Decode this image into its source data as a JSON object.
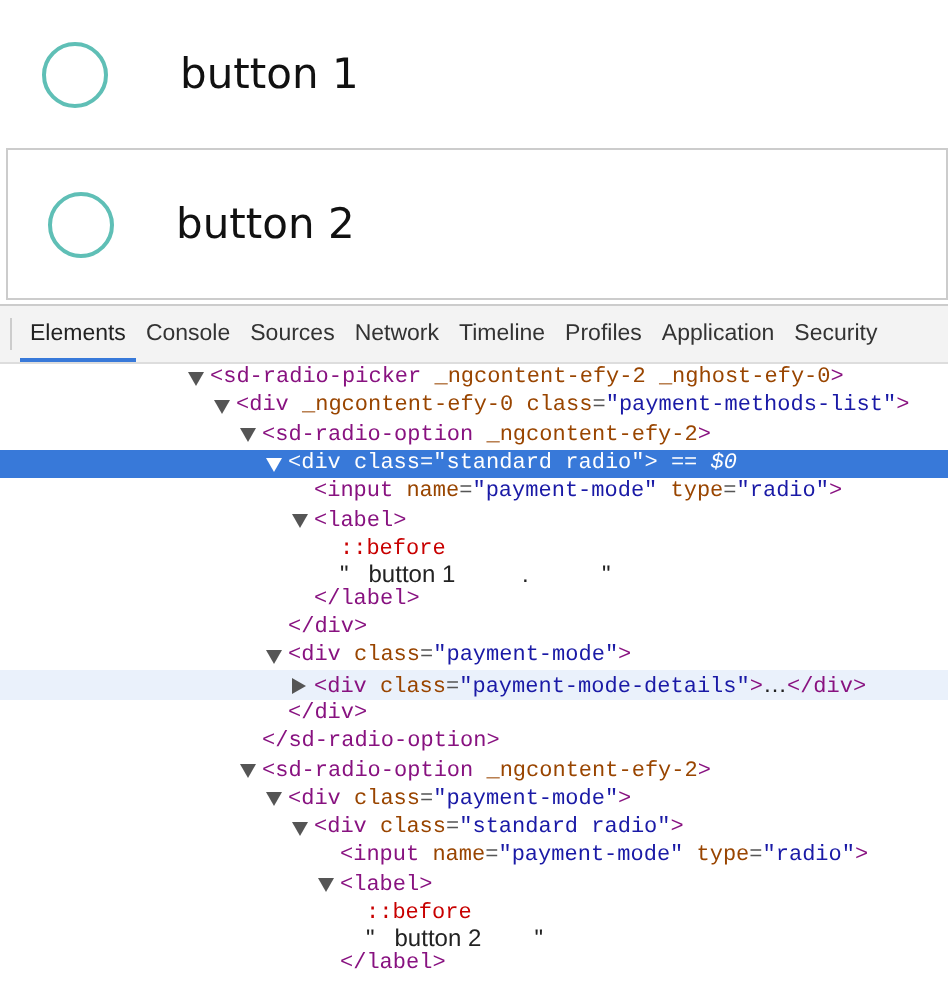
{
  "options": [
    {
      "label": "button 1",
      "selected": false,
      "hovered": false
    },
    {
      "label": "button 2",
      "selected": false,
      "hovered": true
    }
  ],
  "devtools": {
    "tabs": [
      {
        "label": "Elements",
        "selected": true
      },
      {
        "label": "Console",
        "selected": false
      },
      {
        "label": "Sources",
        "selected": false
      },
      {
        "label": "Network",
        "selected": false
      },
      {
        "label": "Timeline",
        "selected": false
      },
      {
        "label": "Profiles",
        "selected": false
      },
      {
        "label": "Application",
        "selected": false
      },
      {
        "label": "Security",
        "selected": false
      }
    ],
    "tree": [
      {
        "expanded": true,
        "selected": false,
        "hovered": false,
        "open": [
          {
            "kind": "tag",
            "t": "<sd-radio-picker"
          },
          {
            "kind": "attr",
            "t": " _ngcontent-efy-2 _nghost-efy-0"
          },
          {
            "kind": "tag",
            "t": ">"
          }
        ],
        "children": [
          {
            "expanded": true,
            "selected": false,
            "hovered": false,
            "open": [
              {
                "kind": "tag",
                "t": "<div"
              },
              {
                "kind": "attr",
                "t": " _ngcontent-efy-0 class"
              },
              {
                "kind": "punct",
                "t": "="
              },
              {
                "kind": "value",
                "t": "\"payment-methods-list\""
              },
              {
                "kind": "tag",
                "t": ">"
              }
            ],
            "children": [
              {
                "expanded": true,
                "selected": false,
                "hovered": false,
                "open": [
                  {
                    "kind": "tag",
                    "t": "<sd-radio-option"
                  },
                  {
                    "kind": "attr",
                    "t": " _ngcontent-efy-2"
                  },
                  {
                    "kind": "tag",
                    "t": ">"
                  }
                ],
                "close": [
                  {
                    "kind": "tag",
                    "t": "</sd-radio-option>"
                  }
                ],
                "children": [
                  {
                    "expanded": true,
                    "selected": true,
                    "hovered": false,
                    "open": [
                      {
                        "kind": "tag",
                        "t": "<div"
                      },
                      {
                        "kind": "attr",
                        "t": " class"
                      },
                      {
                        "kind": "punct",
                        "t": "="
                      },
                      {
                        "kind": "value",
                        "t": "\"standard radio\""
                      },
                      {
                        "kind": "tag",
                        "t": ">"
                      },
                      {
                        "kind": "marker",
                        "t": " == $0"
                      }
                    ],
                    "close": [
                      {
                        "kind": "tag",
                        "t": "</div>"
                      }
                    ],
                    "children": [
                      {
                        "selected": false,
                        "hovered": false,
                        "open": [
                          {
                            "kind": "tag",
                            "t": "<input"
                          },
                          {
                            "kind": "attr",
                            "t": " name"
                          },
                          {
                            "kind": "punct",
                            "t": "="
                          },
                          {
                            "kind": "value",
                            "t": "\"payment-mode\""
                          },
                          {
                            "kind": "attr",
                            "t": " type"
                          },
                          {
                            "kind": "punct",
                            "t": "="
                          },
                          {
                            "kind": "value",
                            "t": "\"radio\""
                          },
                          {
                            "kind": "tag",
                            "t": ">"
                          }
                        ]
                      },
                      {
                        "expanded": true,
                        "selected": false,
                        "hovered": false,
                        "open": [
                          {
                            "kind": "tag",
                            "t": "<label>"
                          }
                        ],
                        "close": [
                          {
                            "kind": "tag",
                            "t": "</label>"
                          }
                        ],
                        "children": [
                          {
                            "selected": false,
                            "hovered": false,
                            "open": [
                              {
                                "kind": "pseudo",
                                "t": "::before"
                              }
                            ]
                          },
                          {
                            "selected": false,
                            "hovered": false,
                            "open": [
                              {
                                "kind": "text",
                                "t": "\"   button 1          .           \""
                              }
                            ]
                          }
                        ]
                      }
                    ]
                  },
                  {
                    "expanded": true,
                    "selected": false,
                    "hovered": false,
                    "open": [
                      {
                        "kind": "tag",
                        "t": "<div"
                      },
                      {
                        "kind": "attr",
                        "t": " class"
                      },
                      {
                        "kind": "punct",
                        "t": "="
                      },
                      {
                        "kind": "value",
                        "t": "\"payment-mode\""
                      },
                      {
                        "kind": "tag",
                        "t": ">"
                      }
                    ],
                    "close": [
                      {
                        "kind": "tag",
                        "t": "</div>"
                      }
                    ],
                    "children": [
                      {
                        "expanded": false,
                        "selected": false,
                        "hovered": true,
                        "open": [
                          {
                            "kind": "tag",
                            "t": "<div"
                          },
                          {
                            "kind": "attr",
                            "t": " class"
                          },
                          {
                            "kind": "punct",
                            "t": "="
                          },
                          {
                            "kind": "value",
                            "t": "\"payment-mode-details\""
                          },
                          {
                            "kind": "tag",
                            "t": ">"
                          },
                          {
                            "kind": "text",
                            "t": "…"
                          },
                          {
                            "kind": "tag",
                            "t": "</div>"
                          }
                        ]
                      }
                    ]
                  }
                ]
              },
              {
                "expanded": true,
                "selected": false,
                "hovered": false,
                "open": [
                  {
                    "kind": "tag",
                    "t": "<sd-radio-option"
                  },
                  {
                    "kind": "attr",
                    "t": " _ngcontent-efy-2"
                  },
                  {
                    "kind": "tag",
                    "t": ">"
                  }
                ],
                "children": [
                  {
                    "expanded": true,
                    "selected": false,
                    "hovered": false,
                    "open": [
                      {
                        "kind": "tag",
                        "t": "<div"
                      },
                      {
                        "kind": "attr",
                        "t": " class"
                      },
                      {
                        "kind": "punct",
                        "t": "="
                      },
                      {
                        "kind": "value",
                        "t": "\"payment-mode\""
                      },
                      {
                        "kind": "tag",
                        "t": ">"
                      }
                    ],
                    "children": [
                      {
                        "expanded": true,
                        "selected": false,
                        "hovered": false,
                        "open": [
                          {
                            "kind": "tag",
                            "t": "<div"
                          },
                          {
                            "kind": "attr",
                            "t": " class"
                          },
                          {
                            "kind": "punct",
                            "t": "="
                          },
                          {
                            "kind": "value",
                            "t": "\"standard radio\""
                          },
                          {
                            "kind": "tag",
                            "t": ">"
                          }
                        ],
                        "children": [
                          {
                            "selected": false,
                            "hovered": false,
                            "open": [
                              {
                                "kind": "tag",
                                "t": "<input"
                              },
                              {
                                "kind": "attr",
                                "t": " name"
                              },
                              {
                                "kind": "punct",
                                "t": "="
                              },
                              {
                                "kind": "value",
                                "t": "\"payment-mode\""
                              },
                              {
                                "kind": "attr",
                                "t": " type"
                              },
                              {
                                "kind": "punct",
                                "t": "="
                              },
                              {
                                "kind": "value",
                                "t": "\"radio\""
                              },
                              {
                                "kind": "tag",
                                "t": ">"
                              }
                            ]
                          },
                          {
                            "expanded": true,
                            "selected": false,
                            "hovered": false,
                            "open": [
                              {
                                "kind": "tag",
                                "t": "<label>"
                              }
                            ],
                            "close": [
                              {
                                "kind": "tag",
                                "t": "</label>"
                              }
                            ],
                            "children": [
                              {
                                "selected": false,
                                "hovered": false,
                                "open": [
                                  {
                                    "kind": "pseudo",
                                    "t": "::before"
                                  }
                                ]
                              },
                              {
                                "selected": false,
                                "hovered": false,
                                "open": [
                                  {
                                    "kind": "text",
                                    "t": "\"   button 2        \""
                                  }
                                ]
                              }
                            ]
                          }
                        ]
                      }
                    ]
                  }
                ]
              }
            ]
          }
        ]
      }
    ]
  }
}
